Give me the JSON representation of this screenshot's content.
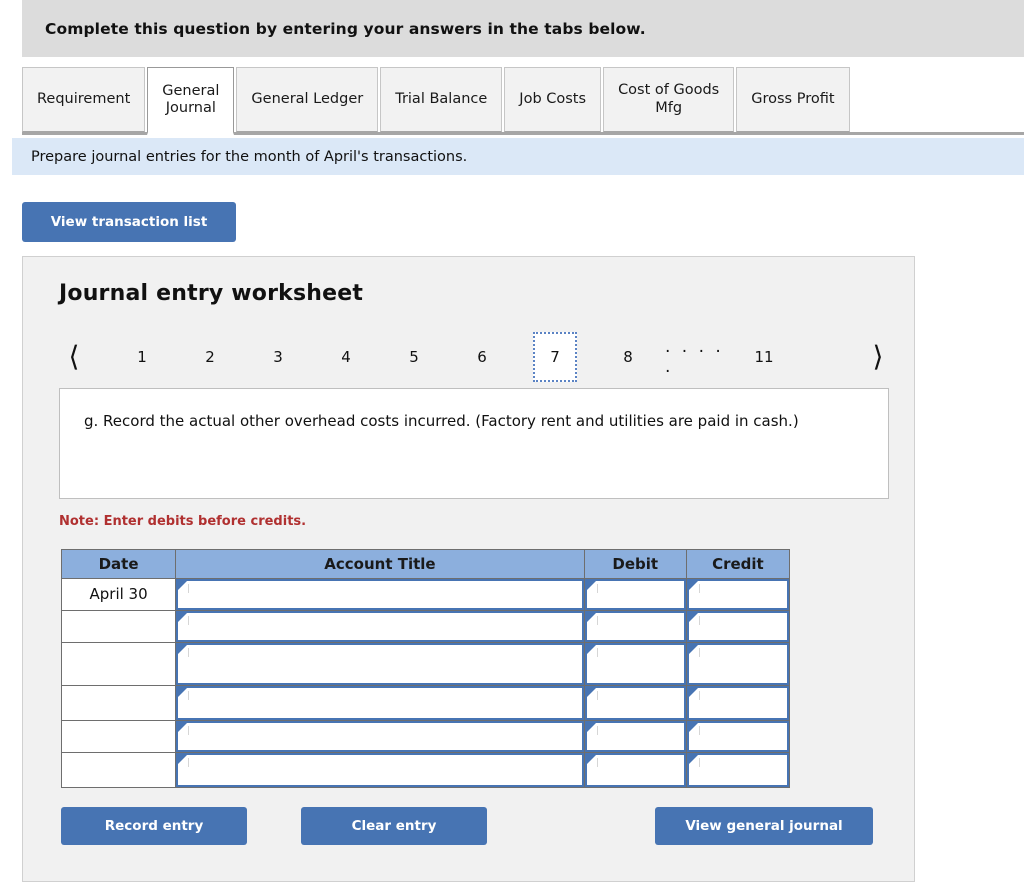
{
  "banner": {
    "text": "Complete this question by entering your answers in the tabs below."
  },
  "tabs": {
    "items": [
      {
        "label": "Requirement",
        "active": false
      },
      {
        "label": "General\nJournal",
        "active": true
      },
      {
        "label": "General Ledger",
        "active": false
      },
      {
        "label": "Trial Balance",
        "active": false
      },
      {
        "label": "Job Costs",
        "active": false
      },
      {
        "label": "Cost of Goods\nMfg",
        "active": false
      },
      {
        "label": "Gross Profit",
        "active": false
      }
    ]
  },
  "instruction": {
    "text": "Prepare journal entries for the month of April's transactions."
  },
  "toolbar": {
    "view_transaction_list_label": "View transaction list"
  },
  "worksheet": {
    "title": "Journal entry worksheet",
    "pager": {
      "prev_icon": "chevron-left-icon",
      "next_icon": "chevron-right-icon",
      "pages": [
        "1",
        "2",
        "3",
        "4",
        "5",
        "6",
        "7",
        "8",
        ". . . . .",
        "11"
      ],
      "selected": "7",
      "selected_index": 6,
      "total_pages": "11"
    },
    "question": "g. Record the actual other overhead costs incurred. (Factory rent and utilities are paid in cash.)",
    "note": "Note: Enter debits before credits.",
    "table": {
      "headers": [
        "Date",
        "Account Title",
        "Debit",
        "Credit"
      ],
      "rows": [
        {
          "date": "April 30",
          "account": "",
          "debit": "",
          "credit": ""
        },
        {
          "date": "",
          "account": "",
          "debit": "",
          "credit": ""
        },
        {
          "date": "",
          "account": "",
          "debit": "",
          "credit": ""
        },
        {
          "date": "",
          "account": "",
          "debit": "",
          "credit": ""
        },
        {
          "date": "",
          "account": "",
          "debit": "",
          "credit": ""
        },
        {
          "date": "",
          "account": "",
          "debit": "",
          "credit": ""
        }
      ]
    },
    "actions": {
      "record_label": "Record entry",
      "clear_label": "Clear entry",
      "view_journal_label": "View general journal"
    }
  },
  "colors": {
    "accent_blue": "#4774b3",
    "table_header_blue": "#8cafdd",
    "instruction_blue": "#dbe8f7",
    "banner_gray": "#dcdcdc",
    "panel_gray": "#f1f1f1",
    "note_red": "#b03030"
  }
}
